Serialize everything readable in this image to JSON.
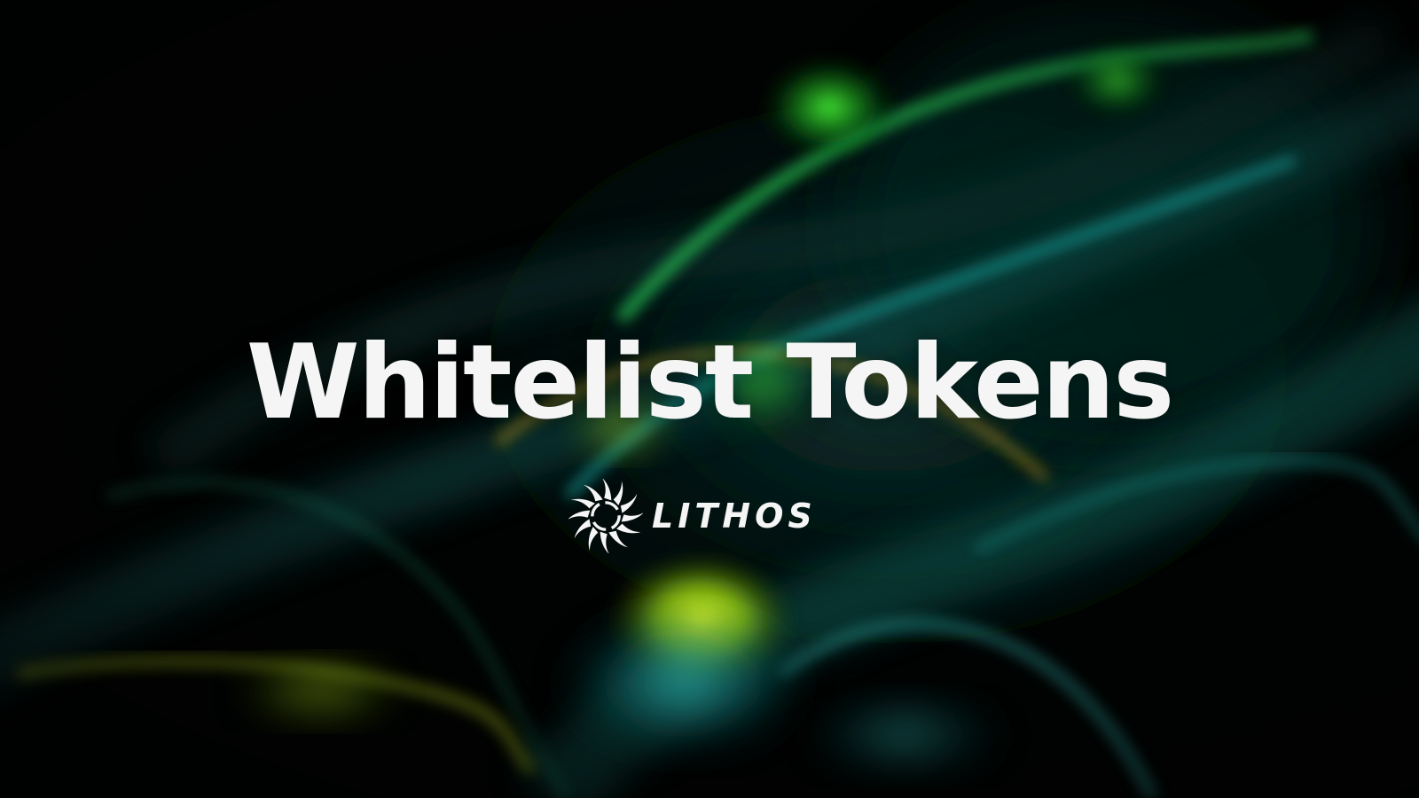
{
  "headline": "Whitelist Tokens",
  "brand": {
    "name": "LITHOS",
    "logo_icon": "swirl-sun-icon"
  },
  "colors": {
    "background": "#010302",
    "text": "#f4f5f4",
    "accent_green": "#3ddc36",
    "accent_lime": "#c8f00a",
    "accent_teal": "#1fb7b0",
    "accent_amber": "#d7a612"
  }
}
